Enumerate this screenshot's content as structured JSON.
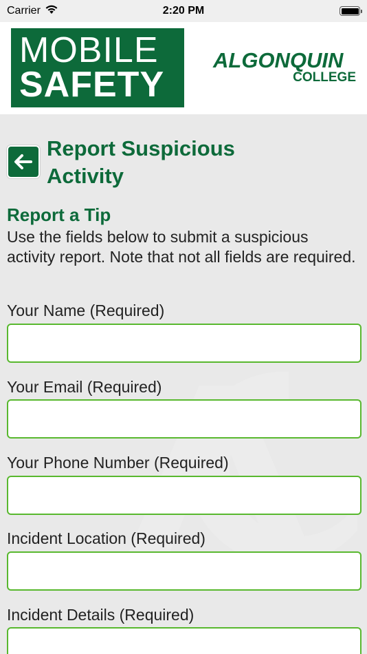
{
  "status_bar": {
    "carrier": "Carrier",
    "time": "2:20 PM"
  },
  "header": {
    "app_logo_line1": "MOBILE",
    "app_logo_line2": "SAFETY",
    "college_name": "ALGONQUIN",
    "college_sub": "COLLEGE"
  },
  "page": {
    "title": "Report Suspicious Activity",
    "section_title": "Report a Tip",
    "intro": "Use the fields below to submit a suspicious activity report. Note that not all fields are required."
  },
  "form": {
    "fields": [
      {
        "label": "Your Name (Required)",
        "value": "",
        "placeholder": ""
      },
      {
        "label": "Your Email (Required)",
        "value": "",
        "placeholder": ""
      },
      {
        "label": "Your Phone Number (Required)",
        "value": "",
        "placeholder": ""
      },
      {
        "label": "Incident Location (Required)",
        "value": "",
        "placeholder": ""
      },
      {
        "label": "Incident Details (Required)",
        "value": "",
        "placeholder": ""
      }
    ]
  },
  "colors": {
    "brand_green": "#0d6a3a",
    "input_border": "#58b82e",
    "background": "#e9e9e9"
  },
  "icons": {
    "back": "arrow-left-icon",
    "wifi": "wifi-icon",
    "battery": "battery-icon"
  }
}
